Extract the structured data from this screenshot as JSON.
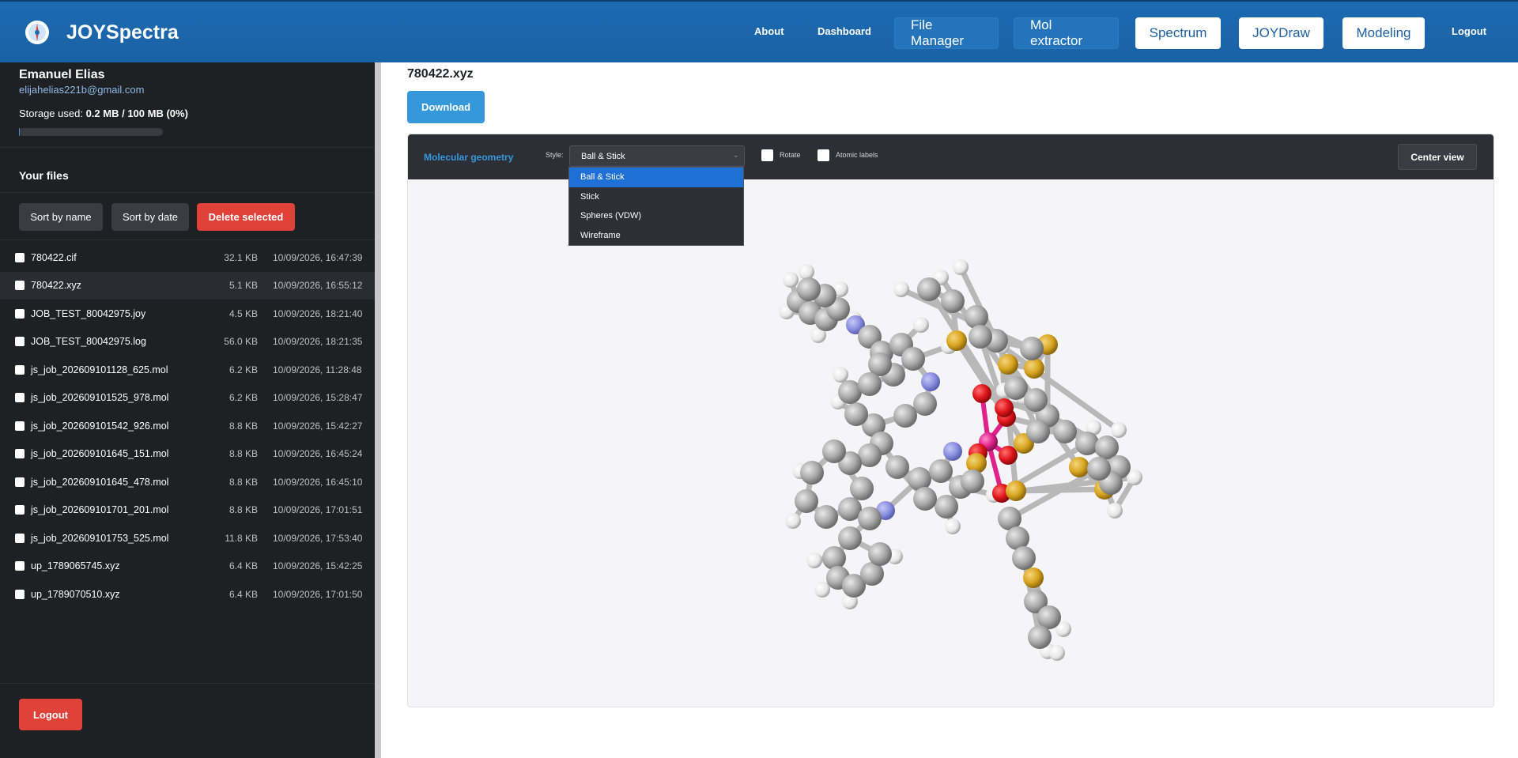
{
  "header": {
    "brand": "JOYSpectra",
    "nav": {
      "about": "About",
      "dashboard": "Dashboard",
      "file_manager": "File Manager",
      "mol_extractor": "Mol extractor",
      "spectrum": "Spectrum",
      "joydraw": "JOYDraw",
      "modeling": "Modeling",
      "logout": "Logout"
    }
  },
  "sidebar": {
    "user_name": "Emanuel Elias",
    "user_email": "elijahelias221b@gmail.com",
    "storage_label": "Storage used:",
    "storage_value": "0.2 MB / 100 MB (0%)",
    "storage_fraction": 0.002,
    "files_title": "Your files",
    "sort_name": "Sort by name",
    "sort_date": "Sort by date",
    "delete_selected": "Delete selected",
    "files": [
      {
        "name": "780422.cif",
        "size": "32.1 KB",
        "date": "10/09/2026, 16:47:39",
        "selected": false
      },
      {
        "name": "780422.xyz",
        "size": "5.1 KB",
        "date": "10/09/2026, 16:55:12",
        "selected": true
      },
      {
        "name": "JOB_TEST_80042975.joy",
        "size": "4.5 KB",
        "date": "10/09/2026, 18:21:40",
        "selected": false
      },
      {
        "name": "JOB_TEST_80042975.log",
        "size": "56.0 KB",
        "date": "10/09/2026, 18:21:35",
        "selected": false
      },
      {
        "name": "js_job_202609101128_625.mol",
        "size": "6.2 KB",
        "date": "10/09/2026, 11:28:48",
        "selected": false
      },
      {
        "name": "js_job_202609101525_978.mol",
        "size": "6.2 KB",
        "date": "10/09/2026, 15:28:47",
        "selected": false
      },
      {
        "name": "js_job_202609101542_926.mol",
        "size": "8.8 KB",
        "date": "10/09/2026, 15:42:27",
        "selected": false
      },
      {
        "name": "js_job_202609101645_151.mol",
        "size": "8.8 KB",
        "date": "10/09/2026, 16:45:24",
        "selected": false
      },
      {
        "name": "js_job_202609101645_478.mol",
        "size": "8.8 KB",
        "date": "10/09/2026, 16:45:10",
        "selected": false
      },
      {
        "name": "js_job_202609101701_201.mol",
        "size": "8.8 KB",
        "date": "10/09/2026, 17:01:51",
        "selected": false
      },
      {
        "name": "js_job_202609101753_525.mol",
        "size": "11.8 KB",
        "date": "10/09/2026, 17:53:40",
        "selected": false
      },
      {
        "name": "up_1789065745.xyz",
        "size": "6.4 KB",
        "date": "10/09/2026, 15:42:25",
        "selected": false
      },
      {
        "name": "up_1789070510.xyz",
        "size": "6.4 KB",
        "date": "10/09/2026, 17:01:50",
        "selected": false
      }
    ],
    "logout": "Logout"
  },
  "main": {
    "file_title": "780422.xyz",
    "download": "Download",
    "viewer": {
      "title": "Molecular geometry",
      "style_label": "Style:",
      "style_selected": "Ball & Stick",
      "style_options": [
        "Ball & Stick",
        "Stick",
        "Spheres (VDW)",
        "Wireframe"
      ],
      "rotate_label": "Rotate",
      "atomic_labels_label": "Atomic labels",
      "center_view": "Center view"
    }
  },
  "colors": {
    "header_blue": "#1d6ab0",
    "sidebar_bg": "#1f2024",
    "accent_blue": "#3598db",
    "danger_red": "#e0423a",
    "atom_carbon": "#a9a9a9",
    "atom_hydrogen": "#f2f2f2",
    "atom_nitrogen": "#8a8fe0",
    "atom_oxygen": "#e0151a",
    "atom_sulfur": "#d9a521",
    "atom_metal": "#e0218a"
  }
}
